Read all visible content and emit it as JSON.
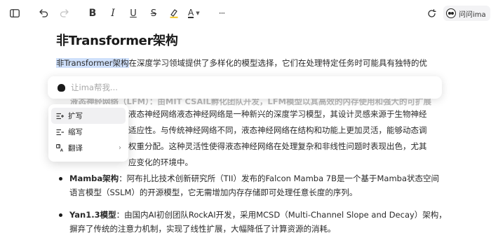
{
  "toolbar": {
    "items": [
      {
        "name": "sidebar-toggle-icon"
      },
      {
        "name": "undo-icon"
      },
      {
        "name": "redo-icon"
      },
      {
        "name": "bold-icon",
        "glyph": "B"
      },
      {
        "name": "italic-icon",
        "glyph": "I"
      },
      {
        "name": "underline-icon",
        "glyph": "U"
      },
      {
        "name": "strikethrough-icon",
        "glyph": "S"
      },
      {
        "name": "highlight-icon"
      },
      {
        "name": "text-color-icon",
        "glyph": "A"
      },
      {
        "name": "more-icon",
        "glyph": "···"
      }
    ],
    "ask_ima_label": "问问ima"
  },
  "document": {
    "title": "非Transformer架构",
    "intro_highlight": "非Transformer架构",
    "intro_line1_rest": "在深度学习领域提供了多样化的模型选择，它们在处理特定任务时可能具有独特的优",
    "lfm_line_faded": "液态神经网络（LFM）：由MIT CSAIL孵化团队开发，LFM模型以其高效的内存使用和强大的可扩展",
    "lfm_line1": "液态神经网络液态神经网络是一种新兴的深度学习模型，其设计灵感来源于生物神经",
    "lfm_line2": "适应性。与传统神经网络不同，液态神经网络在结构和功能上更加灵活，能够动态调",
    "lfm_line3": "权重分配。这种灵活性使得液态神经网络在处理复杂和非线性问题时表现出色，尤其",
    "lfm_line4": "应变化的环境中。",
    "mamba_bold": "Mamba架构",
    "mamba_line1_rest": "：阿布扎比技术创新研究所（TII）发布的Falcon Mamba 7B是一个基于Mamba状态空间",
    "mamba_line2": "语言模型（SSLM）的开源模型，它无需增加内存存储即可处理任意长度的序列。",
    "yan_bold": "Yan1.3模型",
    "yan_line1_rest": "：由国内AI初创团队RockAI开发，采用MCSD（Multi-Channel Slope and Decay）架构，",
    "yan_line2": "摒弃了传统的注意力机制，实现了线性扩展，大幅降低了计算资源的消耗。"
  },
  "askbar": {
    "placeholder": "让ima帮我..."
  },
  "menu": {
    "items": [
      {
        "label": "扩写",
        "icon": "expand-text-icon",
        "active": true
      },
      {
        "label": "缩写",
        "icon": "shorten-text-icon",
        "active": false
      },
      {
        "label": "翻译",
        "icon": "translate-icon",
        "active": false,
        "submenu": true
      }
    ]
  }
}
